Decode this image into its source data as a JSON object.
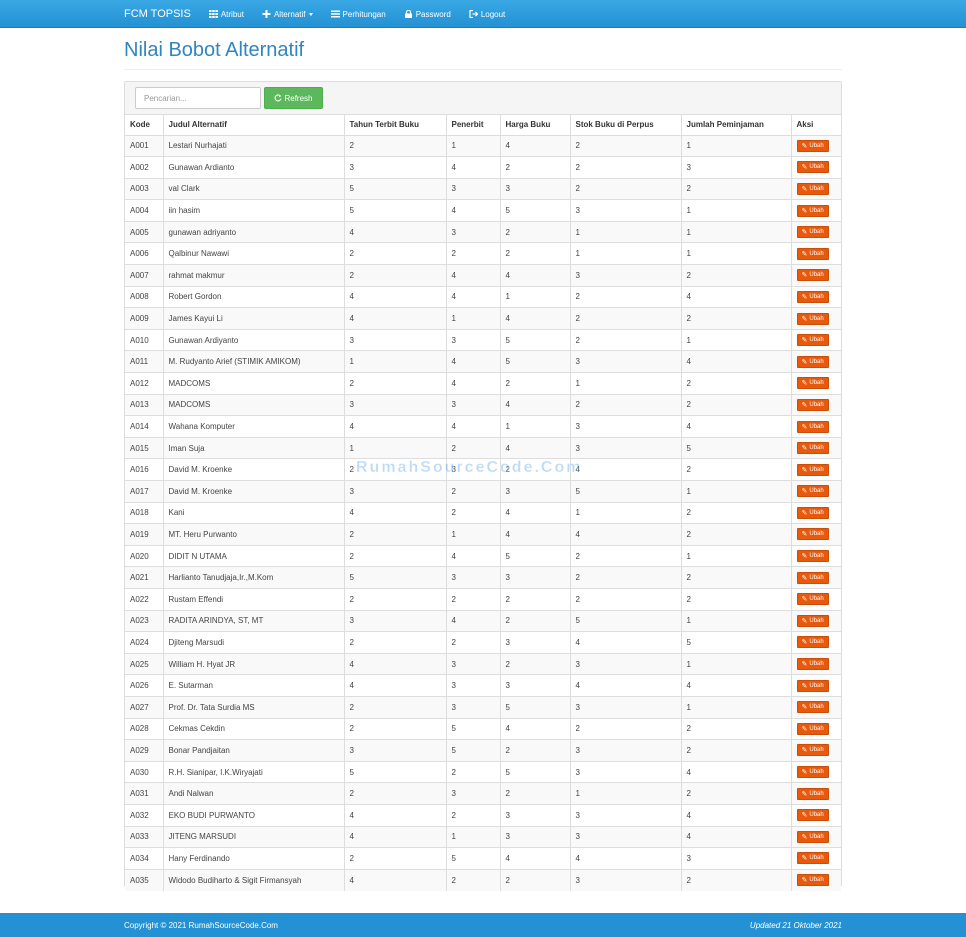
{
  "nav": {
    "brand": "FCM TOPSIS",
    "items": [
      {
        "label": "Atribut",
        "icon": "grid-icon"
      },
      {
        "label": "Alternatif",
        "icon": "plus-icon",
        "dropdown": true
      },
      {
        "label": "Perhitungan",
        "icon": "list-icon"
      },
      {
        "label": "Password",
        "icon": "lock-icon"
      },
      {
        "label": "Logout",
        "icon": "logout-icon"
      }
    ]
  },
  "page": {
    "title": "Nilai Bobot Alternatif"
  },
  "search": {
    "placeholder": "Pencarian..."
  },
  "toolbar": {
    "refresh_label": "Refresh"
  },
  "table": {
    "headers": [
      "Kode",
      "Judul Alternatif",
      "Tahun Terbit Buku",
      "Penerbit",
      "Harga Buku",
      "Stok Buku di Perpus",
      "Jumlah Peminjaman",
      "Aksi"
    ],
    "action_label": "Ubah",
    "rows": [
      [
        "A001",
        "Lestari Nurhajati",
        "2",
        "1",
        "4",
        "2",
        "1"
      ],
      [
        "A002",
        "Gunawan Ardianto",
        "3",
        "4",
        "2",
        "2",
        "3"
      ],
      [
        "A003",
        "val Clark",
        "5",
        "3",
        "3",
        "2",
        "2"
      ],
      [
        "A004",
        "iin hasim",
        "5",
        "4",
        "5",
        "3",
        "1"
      ],
      [
        "A005",
        "gunawan adriyanto",
        "4",
        "3",
        "2",
        "1",
        "1"
      ],
      [
        "A006",
        "Qalbinur Nawawi",
        "2",
        "2",
        "2",
        "1",
        "1"
      ],
      [
        "A007",
        "rahmat makmur",
        "2",
        "4",
        "4",
        "3",
        "2"
      ],
      [
        "A008",
        "Robert Gordon",
        "4",
        "4",
        "1",
        "2",
        "4"
      ],
      [
        "A009",
        "James Kayui Li",
        "4",
        "1",
        "4",
        "2",
        "2"
      ],
      [
        "A010",
        "Gunawan Ardiyanto",
        "3",
        "3",
        "5",
        "2",
        "1"
      ],
      [
        "A011",
        "M. Rudyanto Arief (STIMIK AMIKOM)",
        "1",
        "4",
        "5",
        "3",
        "4"
      ],
      [
        "A012",
        "MADCOMS",
        "2",
        "4",
        "2",
        "1",
        "2"
      ],
      [
        "A013",
        "MADCOMS",
        "3",
        "3",
        "4",
        "2",
        "2"
      ],
      [
        "A014",
        "Wahana Komputer",
        "4",
        "4",
        "1",
        "3",
        "4"
      ],
      [
        "A015",
        "Iman Suja",
        "1",
        "2",
        "4",
        "3",
        "5"
      ],
      [
        "A016",
        "David M. Kroenke",
        "2",
        "3",
        "2",
        "4",
        "2"
      ],
      [
        "A017",
        "David M. Kroenke",
        "3",
        "2",
        "3",
        "5",
        "1"
      ],
      [
        "A018",
        "Kani",
        "4",
        "2",
        "4",
        "1",
        "2"
      ],
      [
        "A019",
        "MT. Heru Purwanto",
        "2",
        "1",
        "4",
        "4",
        "2"
      ],
      [
        "A020",
        "DIDIT N UTAMA",
        "2",
        "4",
        "5",
        "2",
        "1"
      ],
      [
        "A021",
        "Harlianto Tanudjaja,Ir.,M.Kom",
        "5",
        "3",
        "3",
        "2",
        "2"
      ],
      [
        "A022",
        "Rustam Effendi",
        "2",
        "2",
        "2",
        "2",
        "2"
      ],
      [
        "A023",
        "RADITA ARINDYA, ST, MT",
        "3",
        "4",
        "2",
        "5",
        "1"
      ],
      [
        "A024",
        "Djiteng Marsudi",
        "2",
        "2",
        "3",
        "4",
        "5"
      ],
      [
        "A025",
        "William H. Hyat JR",
        "4",
        "3",
        "2",
        "3",
        "1"
      ],
      [
        "A026",
        "E. Sutarman",
        "4",
        "3",
        "3",
        "4",
        "4"
      ],
      [
        "A027",
        "Prof. Dr. Tata Surdia MS",
        "2",
        "3",
        "5",
        "3",
        "1"
      ],
      [
        "A028",
        "Cekmas Cekdin",
        "2",
        "5",
        "4",
        "2",
        "2"
      ],
      [
        "A029",
        "Bonar Pandjaitan",
        "3",
        "5",
        "2",
        "3",
        "2"
      ],
      [
        "A030",
        "R.H. Sianipar, I.K.Wiryajati",
        "5",
        "2",
        "5",
        "3",
        "4"
      ],
      [
        "A031",
        "Andi Nalwan",
        "2",
        "3",
        "2",
        "1",
        "2"
      ],
      [
        "A032",
        "EKO BUDI PURWANTO",
        "4",
        "2",
        "3",
        "3",
        "4"
      ],
      [
        "A033",
        "JITENG MARSUDI",
        "4",
        "1",
        "3",
        "3",
        "4"
      ],
      [
        "A034",
        "Hany Ferdinando",
        "2",
        "5",
        "4",
        "4",
        "3"
      ],
      [
        "A035",
        "Widodo Budiharto & Sigit Firmansyah",
        "4",
        "2",
        "2",
        "3",
        "2"
      ]
    ]
  },
  "watermark": "RumahSourceCode.Com",
  "footer": {
    "copyright": "Copyright © 2021 RumahSourceCode.Com",
    "updated": "Updated 21 Oktober 2021"
  }
}
